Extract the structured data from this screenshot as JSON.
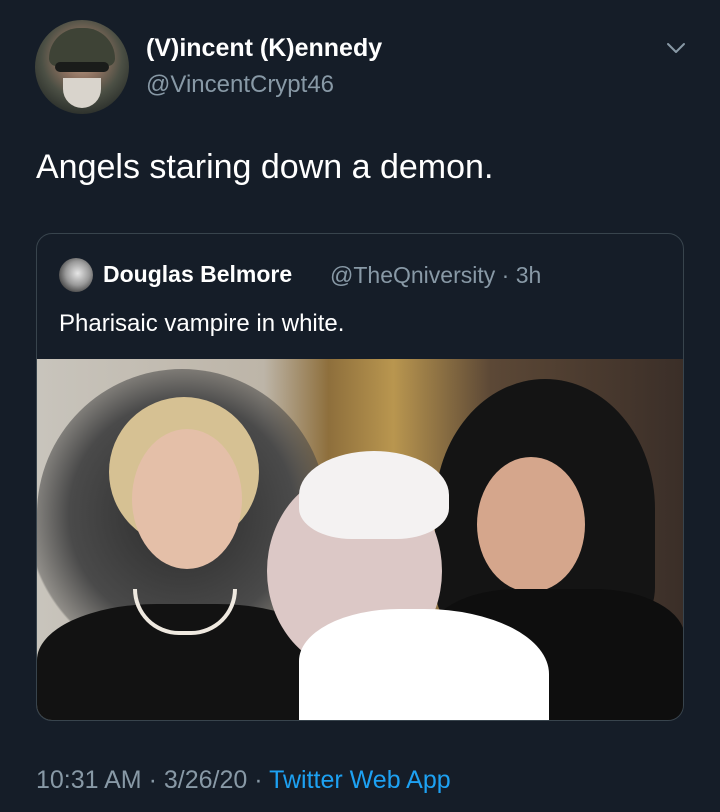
{
  "tweet": {
    "author": {
      "display_name": "(V)incent (K)ennedy",
      "handle": "@VincentCrypt46",
      "avatar_icon": "avatar-soldier-helmet"
    },
    "text": "Angels staring down a demon.",
    "menu_icon": "chevron-down-icon",
    "quoted": {
      "author_name": "Douglas Belmore",
      "author_handle": "@TheQniversity",
      "separator": "·",
      "age": "3h",
      "text": "Pharisaic vampire in white.",
      "photo_icon": "photo-pope-and-two-women"
    },
    "footer": {
      "time": "10:31 AM",
      "sep1": "·",
      "date": "3/26/20",
      "sep2": "·",
      "source": "Twitter Web App"
    }
  },
  "colors": {
    "background": "#151d28",
    "text": "#ffffff",
    "secondary": "#8899a6",
    "link": "#1da1f2",
    "border": "#38444d"
  }
}
